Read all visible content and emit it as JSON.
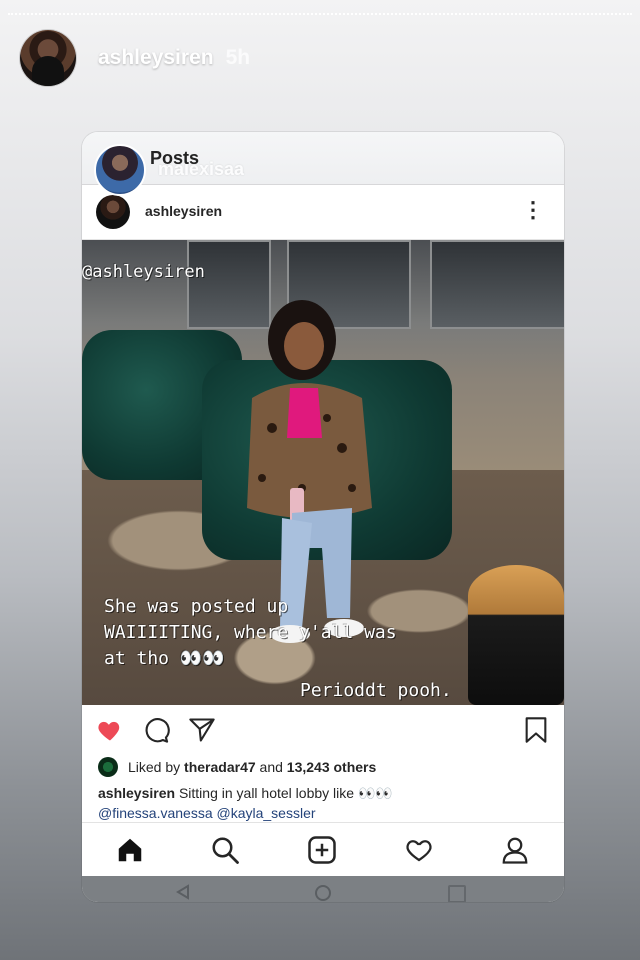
{
  "story": {
    "username": "ashleysiren",
    "time": "5h"
  },
  "embedded": {
    "topbar": {
      "title": "Posts",
      "tagged_user": "malexisaa"
    },
    "post": {
      "username": "ashleysiren",
      "overlay": {
        "tag": "@ashleysiren",
        "line1": "She was posted up",
        "line2": "WAIIIITING, where y'all was",
        "line3": "at tho 👀👀",
        "line4": "Perioddt pooh."
      },
      "likes": {
        "prefix": "Liked by",
        "user": "theradar47",
        "middle": "and",
        "count": "13,243 others"
      },
      "caption": {
        "username": "ashleysiren",
        "text": "Sitting in yall hotel lobby like 👀👀",
        "mentions": "@finessa.vanessa @kayla_sessler"
      }
    },
    "colors": {
      "like_red": "#ed4956",
      "text": "#262626",
      "mention": "#24437a"
    }
  }
}
